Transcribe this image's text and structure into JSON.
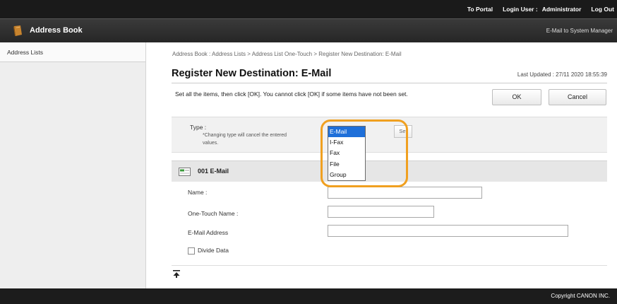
{
  "topbar": {
    "portal_link": "To Portal",
    "login_user_label": "Login User :",
    "login_user_value": "Administrator",
    "logout_link": "Log Out"
  },
  "titlebar": {
    "app_title": "Address Book",
    "mail_to_manager": "E-Mail to System Manager",
    "logo_icon": "address-book-icon"
  },
  "sidebar": {
    "items": [
      {
        "label": "Address Lists"
      }
    ]
  },
  "main": {
    "breadcrumb": "Address Book : Address Lists > Address List One-Touch > Register New Destination: E-Mail",
    "title": "Register New Destination: E-Mail",
    "last_updated": "Last Updated : 27/11 2020 18:55:39",
    "instruction": "Set all the items, then click [OK]. You cannot click [OK] if some items have not been set.",
    "ok_label": "OK",
    "cancel_label": "Cancel"
  },
  "type_section": {
    "label": "Type :",
    "note": "*Changing type will cancel the entered values.",
    "set_label": "Set",
    "selected": "E-Mail",
    "options": [
      "E-Mail",
      "I-Fax",
      "Fax",
      "File",
      "Group"
    ],
    "highlight_color": "#f0a020",
    "selected_color": "#1e6fd9"
  },
  "destination": {
    "header": "001 E-Mail",
    "icon": "email-destination-icon",
    "name_label": "Name :",
    "name_value": "",
    "one_touch_label": "One-Touch Name :",
    "one_touch_value": "",
    "email_label": "E-Mail Address",
    "email_value": "",
    "divide_label": "Divide Data",
    "divide_checked": false
  },
  "footer": {
    "copyright": "Copyright CANON INC."
  }
}
